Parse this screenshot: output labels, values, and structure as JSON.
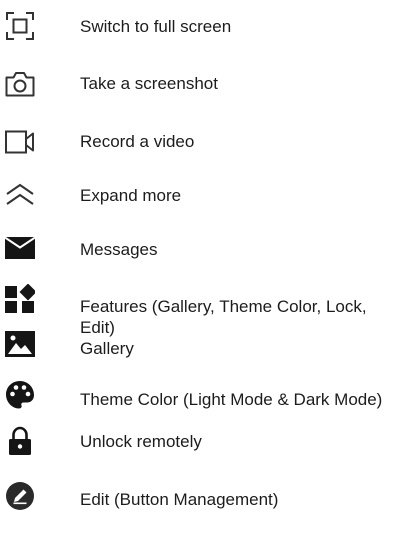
{
  "items": [
    {
      "icon": "fullscreen-icon",
      "label": "Switch to full screen"
    },
    {
      "icon": "camera-icon",
      "label": "Take a screenshot"
    },
    {
      "icon": "video-camera-icon",
      "label": "Record a video"
    },
    {
      "icon": "expand-more-icon",
      "label": "Expand more"
    },
    {
      "icon": "envelope-icon",
      "label": "Messages"
    },
    {
      "icon": "features-grid-icon",
      "label": "Features (Gallery, Theme Color, Lock, Edit)"
    },
    {
      "icon": "gallery-icon",
      "label": "Gallery"
    },
    {
      "icon": "palette-icon",
      "label": "Theme Color (Light Mode & Dark Mode)"
    },
    {
      "icon": "lock-icon",
      "label": "Unlock remotely"
    },
    {
      "icon": "edit-icon",
      "label": "Edit (Button Management)"
    }
  ]
}
